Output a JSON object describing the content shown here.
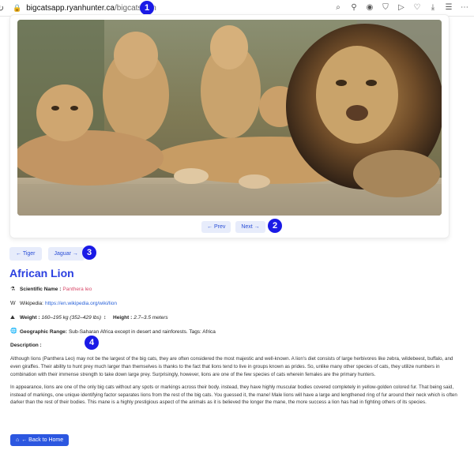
{
  "browser": {
    "url_host": "bigcatsapp.ryanhunter.ca",
    "url_path": "/bigcats/lion"
  },
  "badges": [
    "1",
    "2",
    "3",
    "4"
  ],
  "pager": {
    "prev": "← Prev",
    "next": "Next →"
  },
  "animal_nav": {
    "prev": "← Tiger",
    "next": "Jaguar →"
  },
  "page_title": "African Lion",
  "facts": {
    "scientific_label": "Scientific Name :",
    "scientific_value": "Panthera leo",
    "wikipedia_label": "Wikipedia:",
    "wikipedia_value": "https://en.wikipedia.org/wiki/lion",
    "weight_label": "Weight :",
    "weight_value": "160–195 kg (352–429 lbs)",
    "height_label": "Height :",
    "height_value": "2.7–3.5 meters",
    "range_label": "Geographic Range:",
    "range_value": "Sub-Saharan Africa except in desert and rainforests. Tags: Africa",
    "description_label": "Description :"
  },
  "description": [
    "Although lions (Panthera Leo) may not be the largest of the big cats, they are often considered the most majestic and well-known. A lion's diet consists of large herbivores like zebra, wildebeest, buffalo, and even giraffes. Their ability to hunt prey much larger than themselves is thanks to the fact that lions tend to live in groups known as prides. So, unlike many other species of cats, they utilize numbers in combination with their immense strength to take down large prey. Surprisingly, however, lions are one of the few species of cats wherein females are the primary hunters.",
    "In appearance, lions are one of the only big cats without any spots or markings across their body. instead, they have highly muscular bodies covered completely in yellow-golden colored fur. That being said, instead of markings, one unique identifying factor separates lions from the rest of the big cats. You guessed it, the mane! Male lions will have a large and lengthened ring of fur around their neck which is often darker than the rest of their bodies. This mane is a highly prestigious aspect of the animals as it is believed the longer the mane, the more success a lion has had in fighting others of its species."
  ],
  "home_button": "← Back to Home",
  "colors": {
    "accent": "#2a3fe0",
    "badge": "#1a1ae6",
    "scientific": "#d94a6a"
  }
}
